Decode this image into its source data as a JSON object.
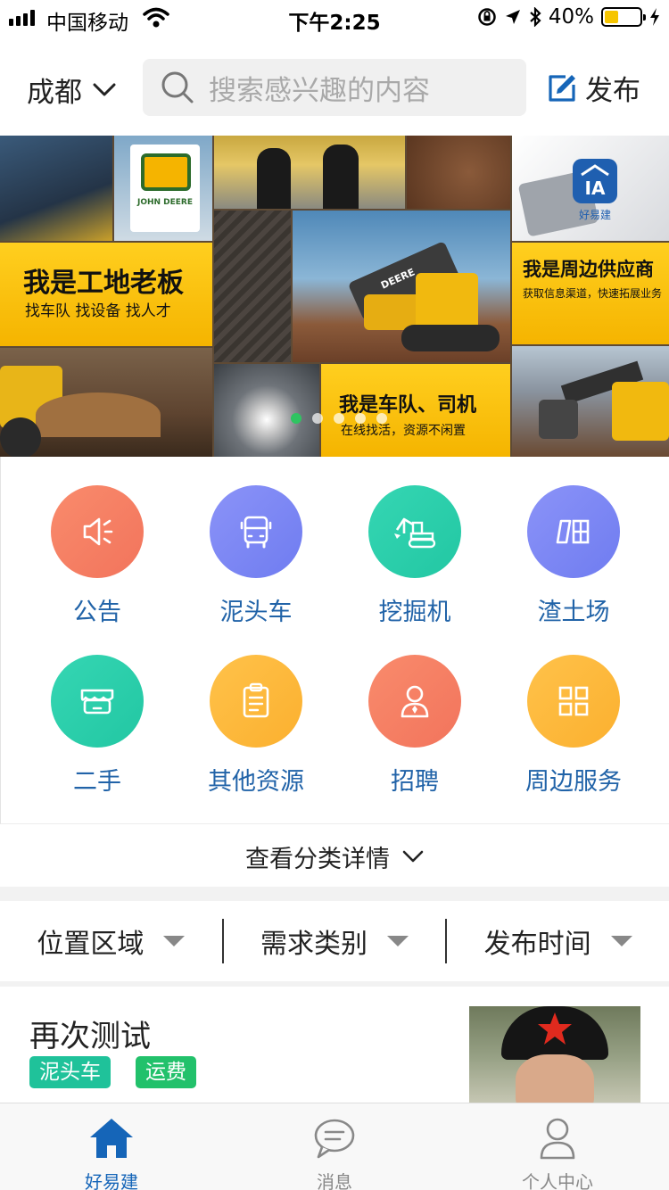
{
  "status_bar": {
    "carrier": "中国移动",
    "time": "下午2:25",
    "battery": "40%",
    "battery_level": 0.4
  },
  "header": {
    "city": "成都",
    "search_placeholder": "搜索感兴趣的内容",
    "publish_label": "发布"
  },
  "banner": {
    "panel1_title": "我是工地老板",
    "panel1_sub": "找车队  找设备  找人才",
    "panel2_title": "我是车队、司机",
    "panel2_sub": "在线找活，资源不闲置",
    "panel3_title": "我是周边供应商",
    "panel3_sub": "获取信息渠道，快速拓展业务",
    "logo_text": "好易建",
    "brand_text": "JOHN DEERE",
    "machine_text": "DEERE",
    "slide_count": 5,
    "active_slide": 1
  },
  "categories": [
    {
      "label": "公告",
      "icon": "announcement-icon",
      "color_from": "#f98b6c",
      "color_to": "#f2745c"
    },
    {
      "label": "泥头车",
      "icon": "truck-icon",
      "color_from": "#8b93f8",
      "color_to": "#6f7cf0"
    },
    {
      "label": "挖掘机",
      "icon": "excavator-icon",
      "color_from": "#35d6b3",
      "color_to": "#22c7a3"
    },
    {
      "label": "渣土场",
      "icon": "yard-icon",
      "color_from": "#8b93f8",
      "color_to": "#6f7cf0"
    },
    {
      "label": "二手",
      "icon": "shop-icon",
      "color_from": "#35d6b3",
      "color_to": "#22c7a3"
    },
    {
      "label": "其他资源",
      "icon": "clipboard-icon",
      "color_from": "#ffc24a",
      "color_to": "#fbb02f"
    },
    {
      "label": "招聘",
      "icon": "person-icon",
      "color_from": "#f98b6c",
      "color_to": "#f2745c"
    },
    {
      "label": "周边服务",
      "icon": "grid-icon",
      "color_from": "#ffc24a",
      "color_to": "#fbb02f"
    }
  ],
  "more_link": "查看分类详情",
  "filters": [
    "位置区域",
    "需求类别",
    "发布时间"
  ],
  "list": [
    {
      "title": "再次测试",
      "tags": [
        {
          "label": "泥头车",
          "color": "#1fc29a"
        },
        {
          "label": "运费",
          "color": "#22c16b"
        }
      ]
    }
  ],
  "tabbar": [
    {
      "label": "好易建",
      "icon": "home-icon",
      "active": true
    },
    {
      "label": "消息",
      "icon": "message-icon",
      "active": false
    },
    {
      "label": "个人中心",
      "icon": "profile-icon",
      "active": false
    }
  ],
  "colors": {
    "accent_blue": "#1565b8",
    "category_text": "#2163a8",
    "banner_yellow": "#f5b400"
  }
}
